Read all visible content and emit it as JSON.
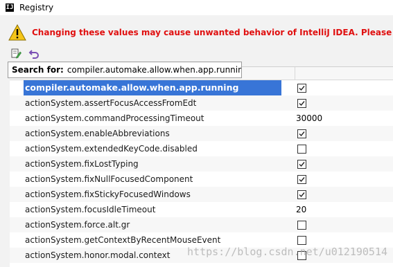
{
  "window": {
    "title": "Registry",
    "icon_name": "intellij-icon",
    "icon_glyph": "IJ"
  },
  "warning": {
    "icon_name": "warning-icon",
    "text": "Changing these values may cause unwanted behavior of IntelliJ IDEA. Please do not"
  },
  "toolbar": {
    "edit_icon": "edit-icon",
    "undo_icon": "undo-icon"
  },
  "search": {
    "label": "Search for:",
    "value": "compiler.automake.allow.when.app.running"
  },
  "rows": [
    {
      "key": "compiler.automake.allow.when.app.running",
      "type": "bool",
      "checked": true,
      "selected": true
    },
    {
      "key": "actionSystem.assertFocusAccessFromEdt",
      "type": "bool",
      "checked": true
    },
    {
      "key": "actionSystem.commandProcessingTimeout",
      "type": "text",
      "value": "30000"
    },
    {
      "key": "actionSystem.enableAbbreviations",
      "type": "bool",
      "checked": true
    },
    {
      "key": "actionSystem.extendedKeyCode.disabled",
      "type": "bool",
      "checked": false
    },
    {
      "key": "actionSystem.fixLostTyping",
      "type": "bool",
      "checked": true
    },
    {
      "key": "actionSystem.fixNullFocusedComponent",
      "type": "bool",
      "checked": true
    },
    {
      "key": "actionSystem.fixStickyFocusedWindows",
      "type": "bool",
      "checked": true
    },
    {
      "key": "actionSystem.focusIdleTimeout",
      "type": "text",
      "value": "20"
    },
    {
      "key": "actionSystem.force.alt.gr",
      "type": "bool",
      "checked": false
    },
    {
      "key": "actionSystem.getContextByRecentMouseEvent",
      "type": "bool",
      "checked": false
    },
    {
      "key": "actionSystem.honor.modal.context",
      "type": "bool",
      "checked": false
    }
  ],
  "watermark": "https://blog.csdn.net/u012190514"
}
